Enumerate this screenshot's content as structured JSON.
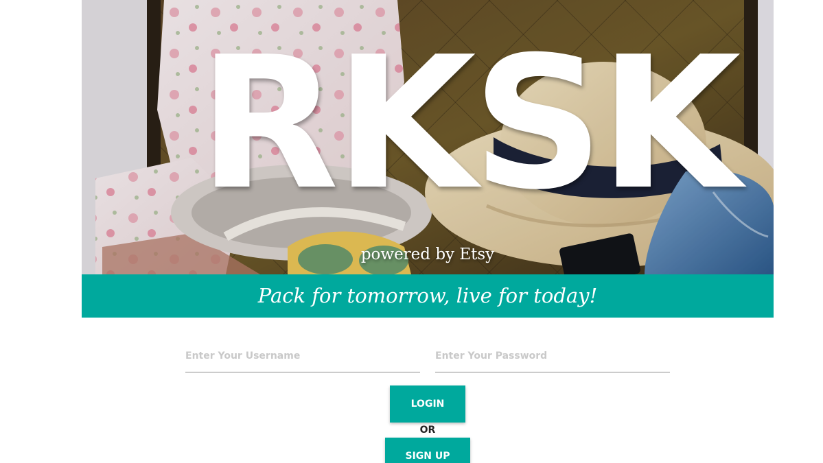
{
  "hero": {
    "logo_text": "RKSK",
    "powered_by": "powered by Etsy",
    "background_description_icon": "suitcase-photo"
  },
  "tagline": {
    "text": "Pack for tomorrow, live for today!"
  },
  "login_form": {
    "username_placeholder": "Enter Your Username",
    "password_placeholder": "Enter Your Password",
    "username_value": "",
    "password_value": "",
    "login_label": "LOGIN",
    "or_label": "OR",
    "signup_label": "SIGN UP"
  },
  "colors": {
    "accent": "#00a99d",
    "text_on_accent": "#ffffff",
    "placeholder": "#c9c9c9",
    "field_underline": "#8a8a8a"
  }
}
